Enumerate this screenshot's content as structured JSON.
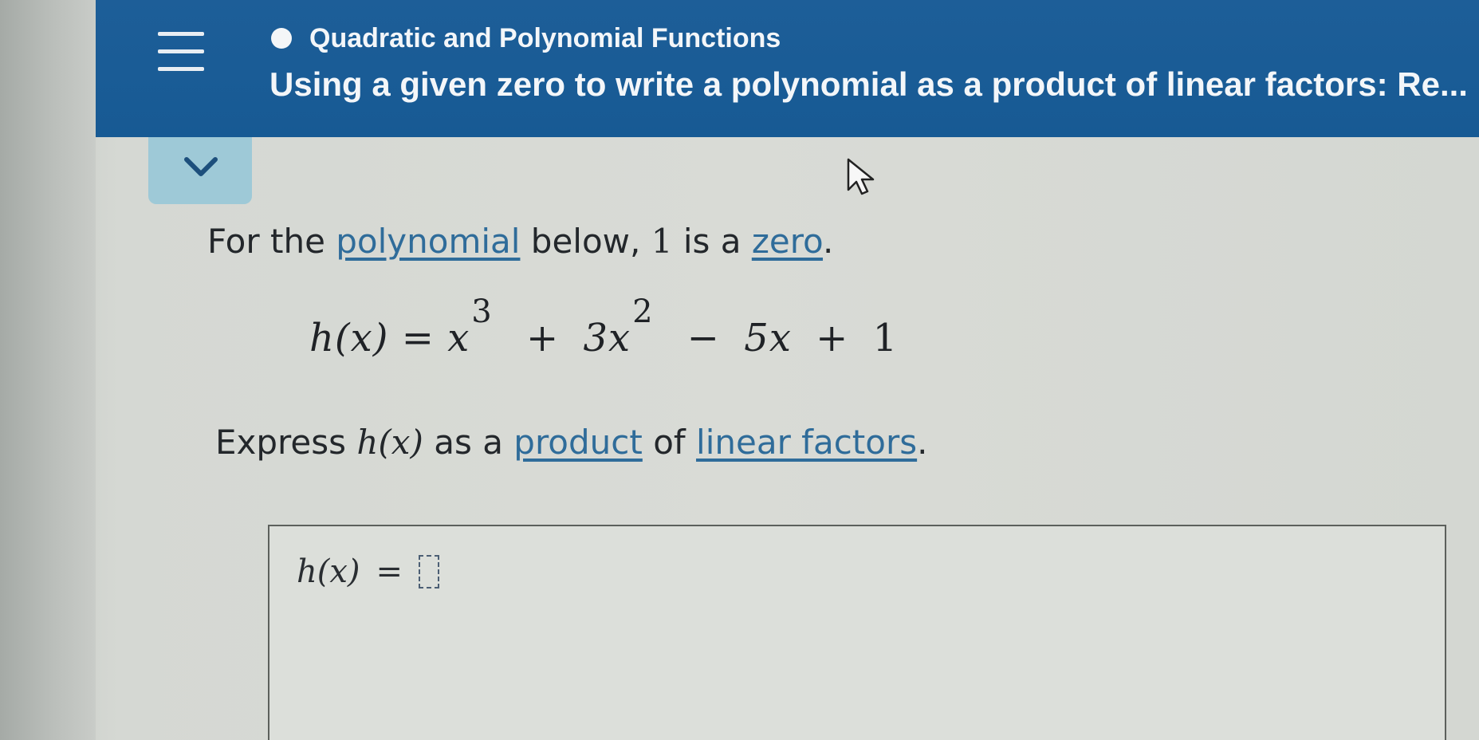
{
  "header": {
    "topic_title": "Quadratic and Polynomial Functions",
    "lesson_title": "Using a given zero to write a polynomial as a product of linear factors: Re...",
    "menu_icon": "hamburger-menu-icon",
    "status_icon": "topic-dot-icon"
  },
  "collapse": {
    "icon": "chevron-down-icon"
  },
  "question": {
    "prefix": "For the ",
    "polynomial_link": "polynomial",
    "middle": " below, ",
    "zero_value": "1",
    "is_a": " is a ",
    "zero_link": "zero",
    "period": "."
  },
  "equation": {
    "lhs": "h(x)",
    "equals": "=",
    "term1_base": "x",
    "term1_exp": "3",
    "op1": "+",
    "term2_base": "3x",
    "term2_exp": "2",
    "op2": "−",
    "term3": "5x",
    "op3": "+",
    "term4": "1"
  },
  "instruction": {
    "prefix": "Express ",
    "func": "h(x)",
    "middle": " as a ",
    "product_link": "product",
    "of": " of ",
    "linear_link": "linear factors",
    "period": "."
  },
  "answer": {
    "label": "h(x)",
    "equals": "=",
    "value": ""
  },
  "colors": {
    "header_bg": "#1d5e98",
    "link": "#2f6c9a",
    "tab_bg": "#9ec9d7"
  }
}
